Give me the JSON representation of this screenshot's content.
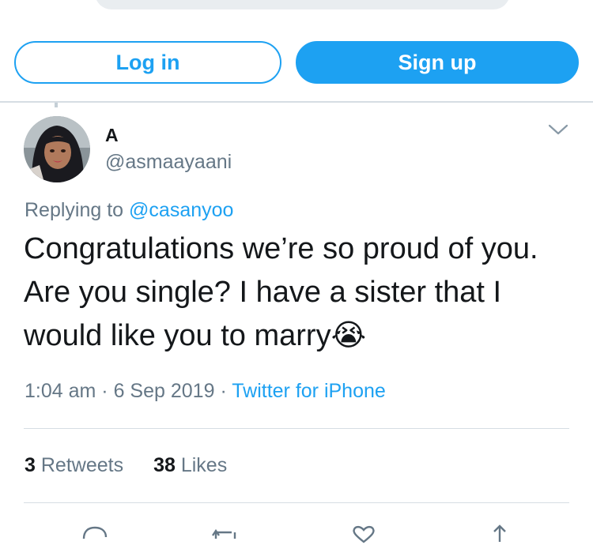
{
  "auth": {
    "login_label": "Log in",
    "signup_label": "Sign up"
  },
  "tweet": {
    "author_name": "A",
    "author_handle": "@asmaayaani",
    "replying_prefix": "Replying to",
    "replying_to": "@casanyoo",
    "text": "Congratulations we’re so proud of you. Are you single? I have a sister that I would like you to marry",
    "emoji": "😭",
    "time": "1:04 am",
    "date": "6 Sep 2019",
    "separator": "·",
    "source": "Twitter for iPhone",
    "retweet_count": "3",
    "retweet_label": "Retweets",
    "like_count": "38",
    "like_label": "Likes"
  },
  "icons": {
    "more": "chevron-down-icon",
    "reply": "reply-icon",
    "retweet": "retweet-icon",
    "like": "heart-icon",
    "share": "share-icon"
  },
  "colors": {
    "accent": "#1da1f2",
    "secondary_text": "#657786",
    "primary_text": "#14171a",
    "divider": "#d6dde3"
  }
}
